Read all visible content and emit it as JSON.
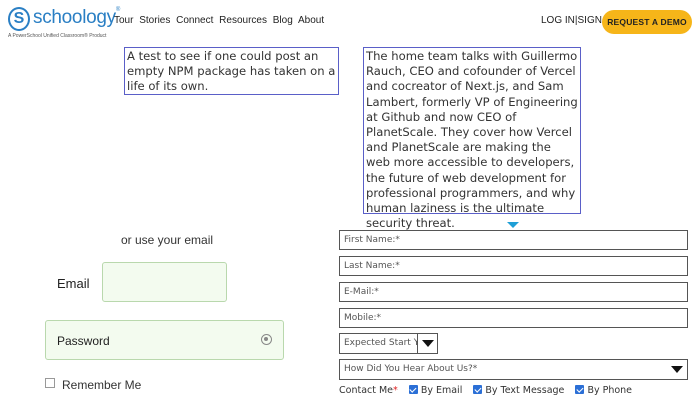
{
  "header": {
    "logo": {
      "letter": "S",
      "word": "schoology",
      "tagline": "A PowerSchool Unified Classroom® Product"
    },
    "nav": [
      "Tour",
      "Stories",
      "Connect",
      "Resources",
      "Blog",
      "About"
    ],
    "login": "LOG IN",
    "signup": "SIGN UP",
    "separator": "|",
    "demo_button": "REQUEST A DEMO"
  },
  "boxes": {
    "box1": "A test to see if one could post an empty NPM package has taken on a life of its own.",
    "box2": "The home team talks with Guillermo Rauch, CEO and cofounder of Vercel and cocreator of Next.js, and Sam Lambert, formerly VP of Engineering at Github and now CEO of PlanetScale. They cover how Vercel and PlanetScale are making the web more accessible to developers, the future of web development for professional programmers, and why human laziness is the ultimate security threat."
  },
  "login_form": {
    "or_email": "or use your email",
    "email_label": "Email",
    "password_label": "Password",
    "remember_me": "Remember Me"
  },
  "demo_form": {
    "first_name": "First Name:*",
    "last_name": "Last Name:*",
    "email": "E-Mail:*",
    "mobile": "Mobile:*",
    "expected_start": "Expected Start Y",
    "hear_about": "How Did You Hear About Us?*",
    "contact_me": "Contact Me",
    "required_mark": "*",
    "options": [
      "By Email",
      "By Text Message",
      "By Phone"
    ]
  },
  "colors": {
    "brand_blue": "#2a7fc4",
    "accent_yellow": "#f6b519",
    "box_border": "#5a5fc8",
    "checkbox_blue": "#2b6fd6"
  }
}
